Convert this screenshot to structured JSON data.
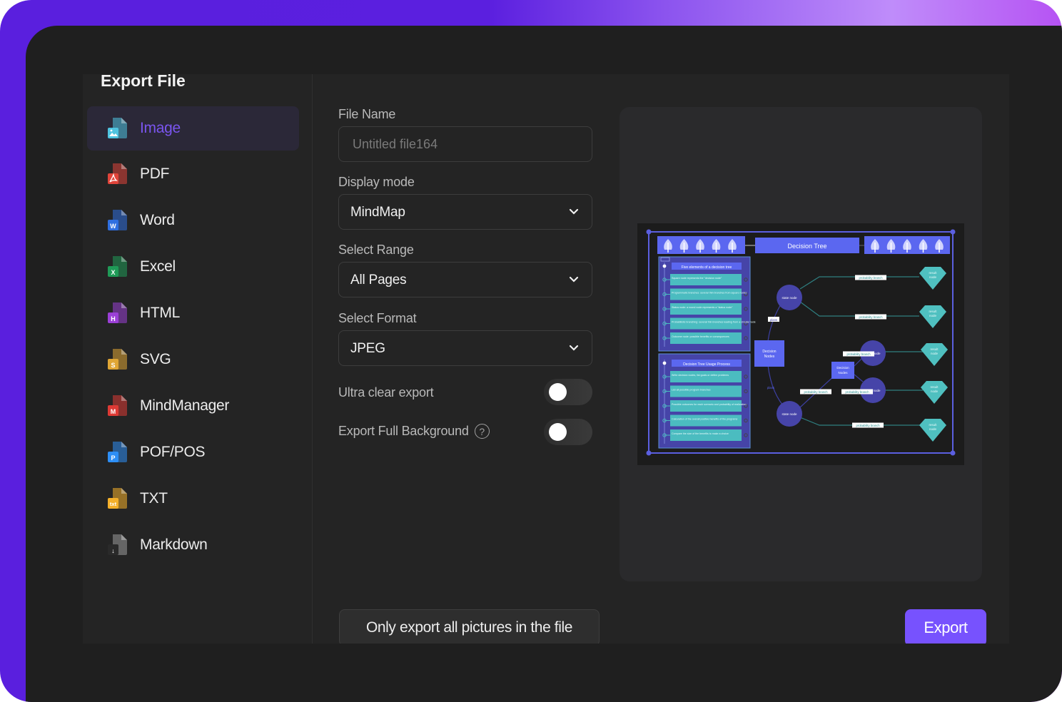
{
  "dialog": {
    "title": "Export File"
  },
  "sidebar": {
    "active_index": 0,
    "items": [
      {
        "label": "Image",
        "icon": "image-file-icon",
        "color": "#4fc3e0",
        "badge": "img"
      },
      {
        "label": "PDF",
        "icon": "pdf-file-icon",
        "color": "#e0443a",
        "badge": "pdf"
      },
      {
        "label": "Word",
        "icon": "word-file-icon",
        "color": "#2f6fe0",
        "badge": "W"
      },
      {
        "label": "Excel",
        "icon": "excel-file-icon",
        "color": "#1f9a57",
        "badge": "X"
      },
      {
        "label": "HTML",
        "icon": "html-file-icon",
        "color": "#9b3fd6",
        "badge": "H"
      },
      {
        "label": "SVG",
        "icon": "svg-file-icon",
        "color": "#e0a635",
        "badge": "S"
      },
      {
        "label": "MindManager",
        "icon": "mindmanager-file-icon",
        "color": "#de3a35",
        "badge": "M"
      },
      {
        "label": "POF/POS",
        "icon": "pof-file-icon",
        "color": "#2d8ef5",
        "badge": "P"
      },
      {
        "label": "TXT",
        "icon": "txt-file-icon",
        "color": "#f5b02a",
        "badge": "txt"
      },
      {
        "label": "Markdown",
        "icon": "markdown-file-icon",
        "color": "#2a2a2a",
        "badge": "↓"
      }
    ]
  },
  "form": {
    "file_name": {
      "label": "File Name",
      "placeholder": "Untitled file164",
      "value": ""
    },
    "display_mode": {
      "label": "Display mode",
      "value": "MindMap"
    },
    "select_range": {
      "label": "Select Range",
      "value": "All Pages"
    },
    "select_format": {
      "label": "Select Format",
      "value": "JPEG"
    },
    "ultra_clear": {
      "label": "Ultra clear export",
      "on": false
    },
    "full_background": {
      "label": "Export Full Background",
      "help": "?",
      "on": false
    }
  },
  "preview": {
    "title": "Decision Tree",
    "left_group_1": {
      "header": "Five elements of a decision tree",
      "items": [
        "Square node represents the \"decision node\"",
        "Programmatic branches: several thin branches from square nodes",
        "Status node: a round node represents a \"status node\"",
        "Probabilistic branching: several thin branches leading from a circular node",
        "Outcome node: possible benefits or consequences"
      ]
    },
    "left_group_2": {
      "header": "Decision Tree Usage Process",
      "items": [
        "Write decision nodes, list goals or define problems",
        "List all possible program branches",
        "Possible outcomes for each scenario and probability of realization",
        "Calculation of the overall positive benefits of the programs",
        "Compare the size of the benefits to make a choice"
      ]
    },
    "decision_node_label": "Decision Nodes",
    "state_node_label": "state node",
    "result_node_label": "result node",
    "branch_label": "probability branch",
    "program_label": "plans",
    "colors": {
      "frame": "#5b5fe0",
      "banner": "#5b67f0",
      "group_bg": "#4644a8",
      "item_bg": "#4bbcc0",
      "state": "#4644a8",
      "result": "#4fc0c0",
      "line": "#2f7f80"
    }
  },
  "footer": {
    "pictures_button": "Only export all pictures in the file",
    "export_button": "Export"
  },
  "colors": {
    "accent": "#7752fe",
    "active_label": "#7a55ef",
    "background": "#1f1f1f",
    "panel": "#242424"
  }
}
